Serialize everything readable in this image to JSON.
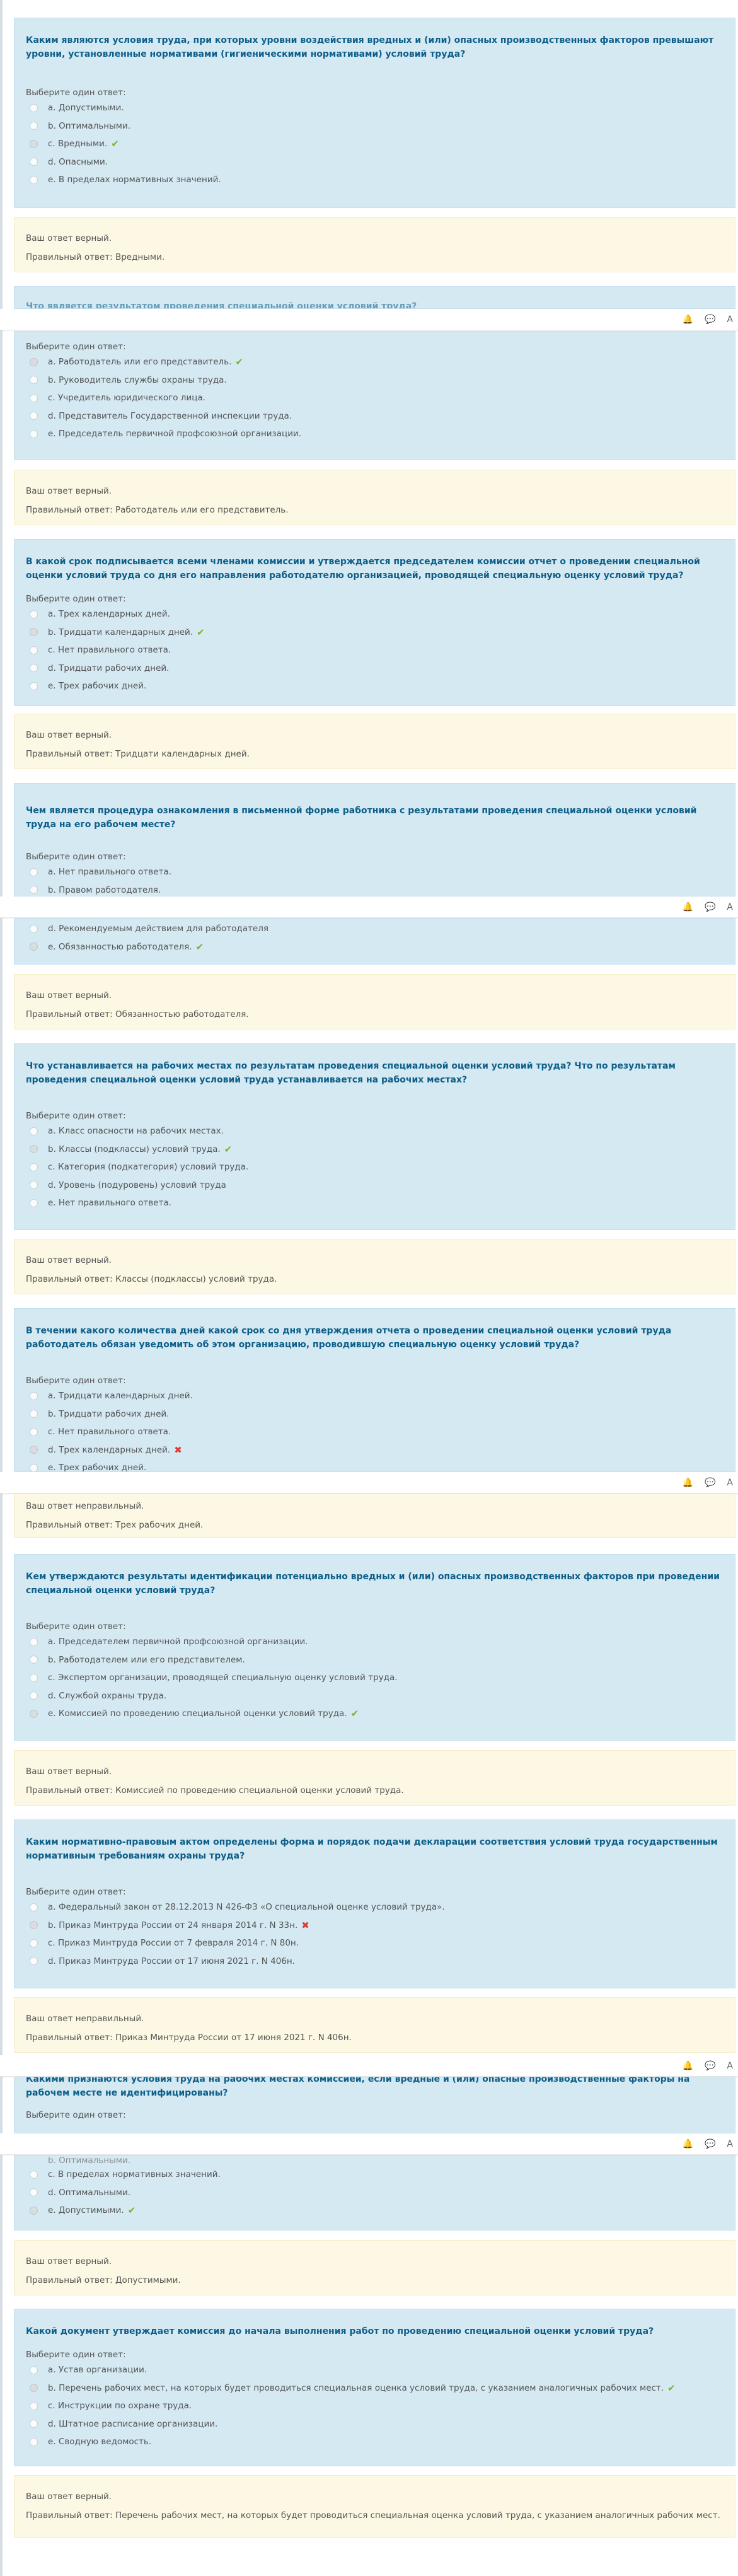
{
  "prompt_label": "Выберите один ответ:",
  "icons": {
    "bell": "bell-icon",
    "chat": "chat-icon",
    "user_initial": "А"
  },
  "q1": {
    "text": "Каким являются условия труда, при которых уровни воздействия вредных и (или) опасных производственных факторов превышают уровни, установленные нормативами (гигиеническими нормативами) условий труда?",
    "options": [
      "a. Допустимыми.",
      "b. Оптимальными.",
      "c. Вредными.",
      "d. Опасными.",
      "e. В пределах нормативных значений."
    ],
    "fb_status": "Ваш ответ верный.",
    "fb_correct": "Правильный ответ: Вредными."
  },
  "q2": {
    "partial_text": "Что является результатом проведения специальной оценки условий труда?",
    "options": [
      "a. Работодатель или его представитель.",
      "b. Руководитель службы охраны труда.",
      "c. Учредитель юридического лица.",
      "d. Представитель Государственной инспекции труда.",
      "e. Председатель первичной профсоюзной организации."
    ],
    "fb_status": "Ваш ответ верный.",
    "fb_correct": "Правильный ответ: Работодатель или его представитель."
  },
  "q3": {
    "text": "В какой срок подписывается всеми членами комиссии и утверждается председателем комиссии отчет о проведении специальной оценки условий труда со дня его направления работодателю организацией, проводящей специальную оценку условий труда?",
    "options": [
      "a. Трех календарных дней.",
      "b. Тридцати календарных дней.",
      "c. Нет правильного ответа.",
      "d. Тридцати рабочих дней.",
      "e. Трех рабочих дней."
    ],
    "fb_status": "Ваш ответ верный.",
    "fb_correct": "Правильный ответ: Тридцати календарных дней."
  },
  "q4": {
    "text": "Чем является процедура ознакомления в письменной форме работника с результатами проведения специальной оценки условий труда на его рабочем месте?",
    "options_top": [
      "a. Нет правильного ответа.",
      "b. Правом работодателя."
    ],
    "options_bottom": [
      "d. Рекомендуемым действием для работодателя",
      "e. Обязанностью работодателя."
    ],
    "fb_status": "Ваш ответ верный.",
    "fb_correct": "Правильный ответ: Обязанностью работодателя."
  },
  "q5": {
    "text": "Что устанавливается на рабочих местах по результатам проведения специальной оценки условий труда? Что по результатам проведения специальной оценки условий труда устанавливается на рабочих местах?",
    "options": [
      "a. Класс опасности на рабочих местах.",
      "b. Классы (подклассы) условий труда.",
      "c. Категория (подкатегория) условий труда.",
      "d. Уровень (подуровень) условий труда",
      "e. Нет правильного ответа."
    ],
    "fb_status": "Ваш ответ верный.",
    "fb_correct": "Правильный ответ: Классы (подклассы) условий труда."
  },
  "q6": {
    "text": "В течении какого количества дней какой срок со дня утверждения отчета о проведении специальной оценки условий труда работодатель обязан уведомить об этом организацию, проводившую специальную оценку условий труда?",
    "options": [
      "a. Тридцати календарных дней.",
      "b. Тридцати рабочих дней.",
      "c. Нет правильного ответа.",
      "d. Трех календарных дней.",
      "e. Трех рабочих дней."
    ],
    "fb_status": "Ваш ответ неправильный.",
    "fb_correct": "Правильный ответ: Трех рабочих дней."
  },
  "q7": {
    "text": "Кем утверждаются результаты идентификации потенциально вредных и (или) опасных производственных факторов при проведении специальной оценки условий труда?",
    "options": [
      "a. Председателем первичной профсоюзной организации.",
      "b. Работодателем или его представителем.",
      "c. Экспертом организации, проводящей специальную оценку условий труда.",
      "d. Службой охраны труда.",
      "e. Комиссией по проведению специальной оценки условий труда."
    ],
    "fb_status": "Ваш ответ верный.",
    "fb_correct": "Правильный ответ: Комиссией по проведению специальной оценки условий труда."
  },
  "q8": {
    "text": "Каким нормативно-правовым актом определены форма и порядок подачи декларации соответствия условий труда государственным нормативным требованиям охраны труда?",
    "options": [
      "a. Федеральный закон от 28.12.2013 N 426-ФЗ «О специальной оценке условий труда».",
      "b. Приказ Минтруда России от 24 января 2014 г. N 33н.",
      "c. Приказ Минтруда России от 7 февраля 2014 г. N 80н.",
      "d. Приказ Минтруда России от 17 июня 2021 г. N 406н."
    ],
    "fb_status": "Ваш ответ неправильный.",
    "fb_correct": "Правильный ответ: Приказ Минтруда России от 17 июня 2021 г. N 406н."
  },
  "q9": {
    "text": "Какими признаются условия труда на рабочих местах комиссией, если вредные и (или) опасные производственные факторы на рабочем месте не идентифицированы?",
    "options_partial": "b. Оптимальными.",
    "options": [
      "c. В пределах нормативных значений.",
      "d. Оптимальными.",
      "e. Допустимыми."
    ],
    "fb_status": "Ваш ответ верный.",
    "fb_correct": "Правильный ответ: Допустимыми."
  },
  "q10": {
    "text": "Какой документ утверждает комиссия до начала выполнения работ по проведению специальной оценки условий труда?",
    "options": [
      "a. Устав организации.",
      "b. Перечень рабочих мест, на которых будет проводиться специальная оценка условий труда, с указанием аналогичных рабочих мест.",
      "c. Инструкции по охране труда.",
      "d. Штатное расписание организации.",
      "e. Сводную ведомость."
    ],
    "fb_status": "Ваш ответ верный.",
    "fb_correct": "Правильный ответ: Перечень рабочих мест, на которых будет проводиться специальная оценка условий труда, с указанием аналогичных рабочих мест."
  }
}
